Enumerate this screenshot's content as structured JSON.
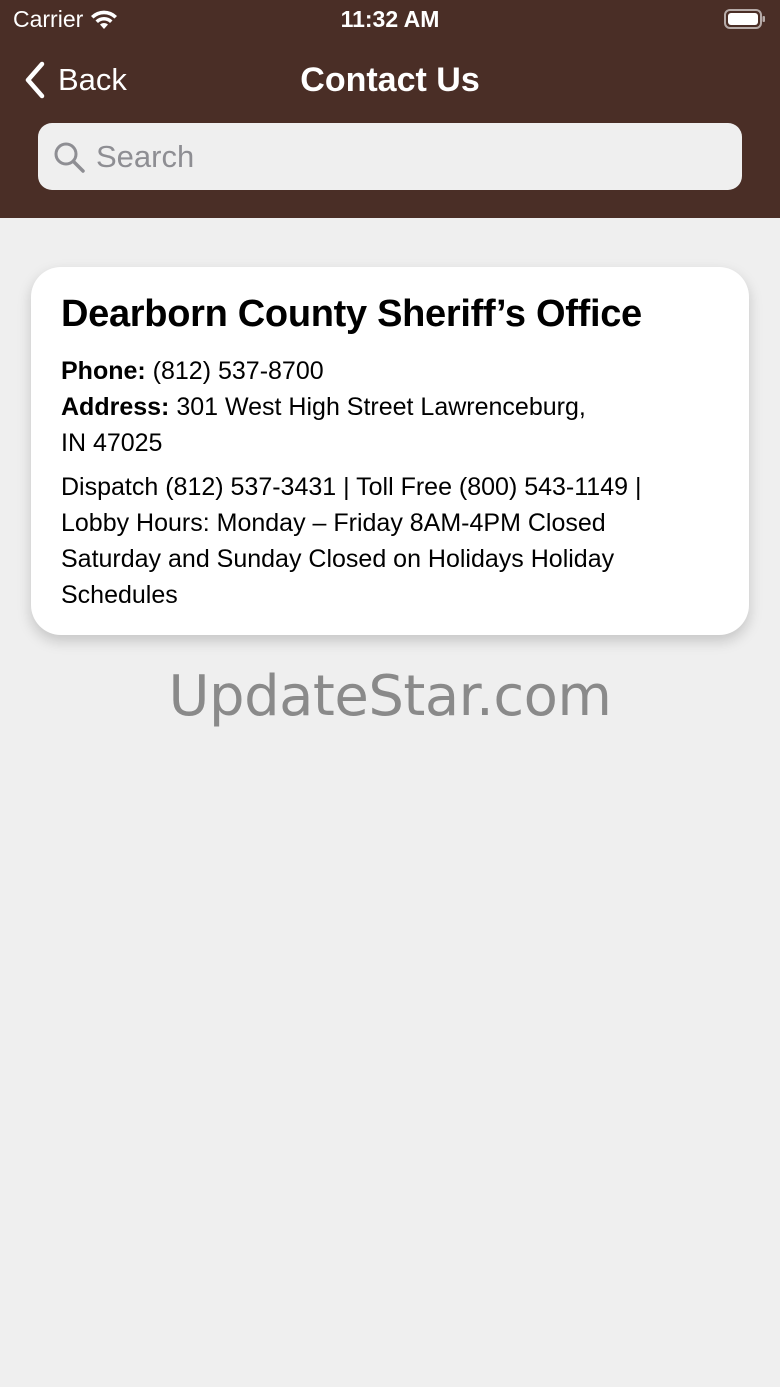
{
  "status_bar": {
    "carrier": "Carrier",
    "time": "11:32 AM"
  },
  "nav": {
    "back_label": "Back",
    "title": "Contact Us"
  },
  "search": {
    "placeholder": "Search",
    "value": ""
  },
  "contact_card": {
    "title": "Dearborn County Sheriff’s Office",
    "phone_label": "Phone:",
    "phone_value": "(812) 537-8700",
    "address_label": "Address:",
    "address_line1": "301 West High Street Lawrenceburg,",
    "address_line2": "IN 47025",
    "notes_line1": "Dispatch (812) 537-3431 | Toll Free (800) 543-1149 |",
    "notes_line2": "Lobby Hours: Monday – Friday 8AM-4PM Closed",
    "notes_line3": "Saturday and Sunday Closed on Holidays Holiday",
    "notes_line4": "Schedules"
  },
  "watermark": "UpdateStar.com",
  "colors": {
    "header_bg": "#4a2e26",
    "page_bg": "#efefef",
    "card_bg": "#ffffff"
  },
  "icons": [
    "wifi-icon",
    "battery-icon",
    "chevron-left-icon",
    "search-icon"
  ]
}
